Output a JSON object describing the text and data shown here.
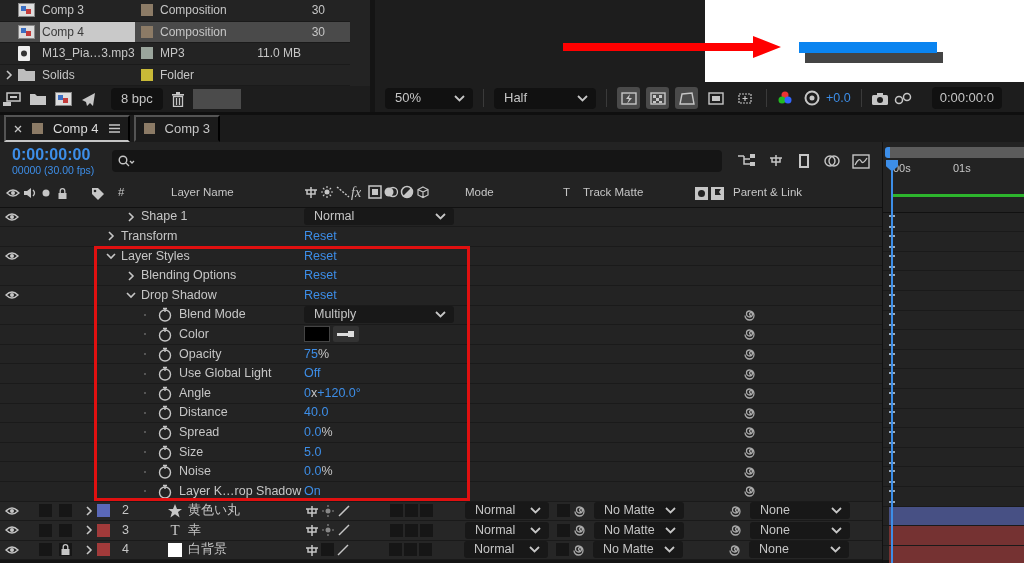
{
  "project": {
    "items": [
      {
        "kind": "comp",
        "name": "Comp 3",
        "color": "#8c7b66",
        "type": "Composition",
        "column_5": "30",
        "selected": false
      },
      {
        "kind": "comp",
        "name": "Comp 4",
        "color": "#8c7b66",
        "type": "Composition",
        "column_5": "30",
        "selected": true
      },
      {
        "kind": "audio",
        "name": "M13_Pia…3.mp3",
        "color": "#9aa59c",
        "type": "MP3",
        "column_4": "11.0 MB",
        "selected": false
      },
      {
        "kind": "folder",
        "name": "Solids",
        "color": "#c8b937",
        "type": "Folder",
        "expanded": false,
        "selected": false
      }
    ],
    "bit_depth": "8 bpc"
  },
  "viewer": {
    "zoom": "50%",
    "resolution": "Half",
    "toggles": [
      {
        "on": true
      },
      {
        "on": true
      },
      {
        "on": true
      },
      {
        "on": false
      },
      {
        "on": false
      }
    ],
    "exposure": "+0.0",
    "timecode": "0:00:00:0"
  },
  "timeline": {
    "tabs": [
      {
        "label": "Comp 4",
        "color": "#8c7b66",
        "selected": true
      },
      {
        "label": "Comp 3",
        "color": "#8c7b66",
        "selected": false
      }
    ],
    "timecode": "0:00:00:00",
    "frame_info": "00000 (30.00 fps)",
    "columns": {
      "number": "#",
      "layer_name": "Layer Name",
      "effects": "fx",
      "mode": "Mode",
      "preserve": "T",
      "track_matte": "Track Matte",
      "parent": "Parent & Link"
    },
    "ruler": [
      "00s",
      "01s"
    ],
    "properties": [
      {
        "kind": "offscreen",
        "children": [
          {
            "kind": "group",
            "label": "Shape 1",
            "expanded": false,
            "visible": true,
            "value": {
              "kind": "dropdown",
              "text": "Normal"
            }
          }
        ]
      },
      {
        "kind": "group",
        "label": "Transform",
        "expanded": false,
        "visible": false,
        "value": {
          "kind": "link",
          "text": "Reset"
        }
      },
      {
        "kind": "group",
        "label": "Layer Styles",
        "expanded": true,
        "visible": true,
        "value": {
          "kind": "link",
          "text": "Reset"
        },
        "children": [
          {
            "kind": "group",
            "label": "Blending Options",
            "expanded": false,
            "visible": false,
            "value": {
              "kind": "link",
              "text": "Reset"
            }
          },
          {
            "kind": "group",
            "label": "Drop Shadow",
            "expanded": true,
            "visible": true,
            "value": {
              "kind": "link",
              "text": "Reset"
            },
            "children": [
              {
                "kind": "property",
                "label": "Blend Mode",
                "value": {
                  "kind": "dropdown",
                  "text": "Multiply"
                }
              },
              {
                "kind": "property",
                "label": "Color",
                "value": {
                  "kind": "color",
                  "color": "#000000"
                }
              },
              {
                "kind": "property",
                "label": "Opacity",
                "value": {
                  "kind": "segments",
                  "segments": [
                    {
                      "text": "75",
                      "editable": true
                    },
                    {
                      "text": "%",
                      "editable": false
                    }
                  ]
                }
              },
              {
                "kind": "property",
                "label": "Use Global Light",
                "value": {
                  "kind": "segments",
                  "segments": [
                    {
                      "text": "Off",
                      "editable": true
                    }
                  ]
                }
              },
              {
                "kind": "property",
                "label": "Angle",
                "value": {
                  "kind": "segments",
                  "segments": [
                    {
                      "text": "0",
                      "editable": true
                    },
                    {
                      "text": "x",
                      "editable": false
                    },
                    {
                      "text": "+120.0°",
                      "editable": true
                    }
                  ]
                }
              },
              {
                "kind": "property",
                "label": "Distance",
                "value": {
                  "kind": "segments",
                  "segments": [
                    {
                      "text": "40.0",
                      "editable": true
                    }
                  ]
                }
              },
              {
                "kind": "property",
                "label": "Spread",
                "value": {
                  "kind": "segments",
                  "segments": [
                    {
                      "text": "0.0",
                      "editable": true
                    },
                    {
                      "text": "%",
                      "editable": false
                    }
                  ]
                }
              },
              {
                "kind": "property",
                "label": "Size",
                "value": {
                  "kind": "segments",
                  "segments": [
                    {
                      "text": "5.0",
                      "editable": true
                    }
                  ]
                }
              },
              {
                "kind": "property",
                "label": "Noise",
                "value": {
                  "kind": "segments",
                  "segments": [
                    {
                      "text": "0.0",
                      "editable": true
                    },
                    {
                      "text": "%",
                      "editable": false
                    }
                  ]
                }
              },
              {
                "kind": "property",
                "label": "Layer K…rop Shadow",
                "value": {
                  "kind": "segments",
                  "segments": [
                    {
                      "text": "On",
                      "editable": true
                    }
                  ]
                }
              }
            ]
          }
        ]
      }
    ],
    "layers": [
      {
        "number": "2",
        "kind": "shape",
        "name": "黄色い丸",
        "color": "#5a68b8",
        "visible": true,
        "locked": false,
        "collapse": true,
        "mode": "Normal",
        "track_matte": "No Matte",
        "parent": "None"
      },
      {
        "number": "3",
        "kind": "text",
        "glyph": "T",
        "name": "幸",
        "color": "#a13a3a",
        "visible": true,
        "locked": false,
        "collapse": true,
        "mode": "Normal",
        "track_matte": "No Matte",
        "parent": "None"
      },
      {
        "number": "4",
        "kind": "solid",
        "name": "白背景",
        "color": "#a13a3a",
        "visible": true,
        "locked": true,
        "collapse": false,
        "mode": "Normal",
        "track_matte": "No Matte",
        "parent": "None"
      }
    ]
  }
}
